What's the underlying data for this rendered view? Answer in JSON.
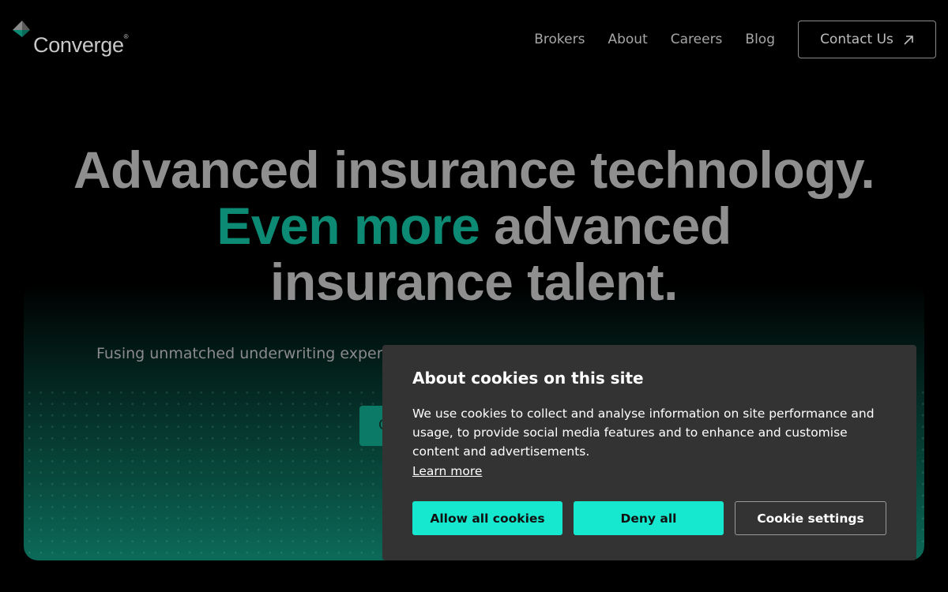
{
  "brand": {
    "name": "Converge",
    "mark": "®",
    "logo_icon": "converge-logo-icon",
    "accent": "#0d8a73"
  },
  "nav": {
    "items": [
      "Brokers",
      "About",
      "Careers",
      "Blog"
    ],
    "contact_label": "Contact Us",
    "contact_icon": "arrow-up-right-icon"
  },
  "hero": {
    "line1": "Advanced insurance technology.",
    "line2_accent": "Even more",
    "line2_rest": "advanced",
    "line3": "insurance talent.",
    "subtext": "Fusing unmatched underwriting exper",
    "cta_partial": "C"
  },
  "cookie_banner": {
    "title": "About cookies on this site",
    "body": "We use cookies to collect and analyse information on site performance and usage, to provide social media features and to enhance and customise content and advertisements.",
    "learn_more": "Learn more",
    "allow_label": "Allow all cookies",
    "deny_label": "Deny all",
    "settings_label": "Cookie settings",
    "button_color": "#16e8cf",
    "background": "#333333"
  }
}
